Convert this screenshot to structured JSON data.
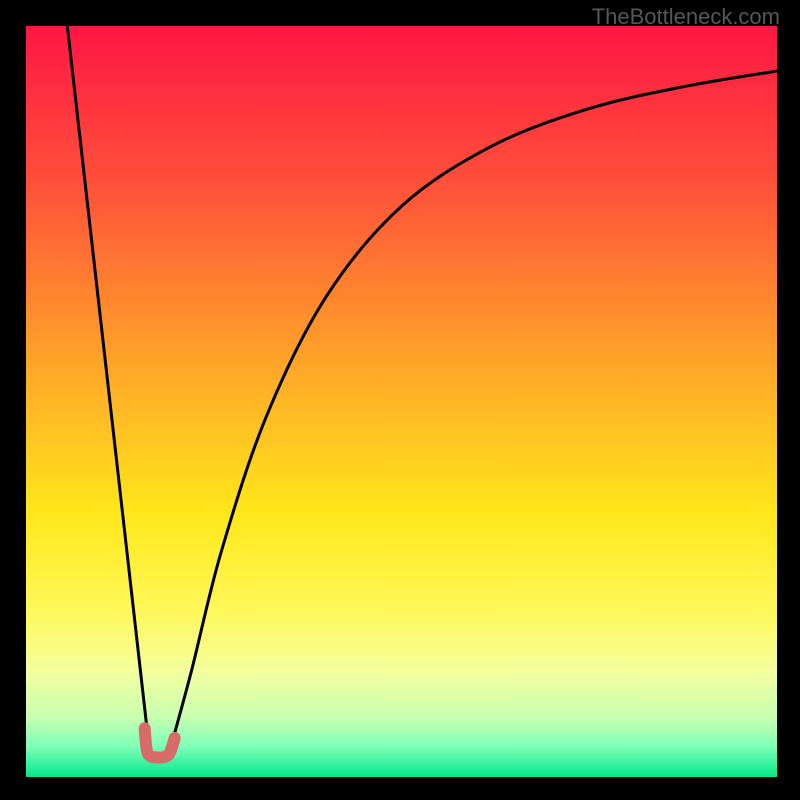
{
  "watermark": "TheBottleneck.com",
  "chart_data": {
    "type": "line",
    "title": "",
    "xlabel": "",
    "ylabel": "",
    "xlim": [
      0,
      100
    ],
    "ylim": [
      0,
      100
    ],
    "gradient_stops": [
      {
        "offset": 0,
        "color": "#ff1744"
      },
      {
        "offset": 20,
        "color": "#ff4d3a"
      },
      {
        "offset": 45,
        "color": "#ffa528"
      },
      {
        "offset": 65,
        "color": "#ffe71a"
      },
      {
        "offset": 78,
        "color": "#fff85a"
      },
      {
        "offset": 86,
        "color": "#f3ff9e"
      },
      {
        "offset": 92,
        "color": "#c8ffb0"
      },
      {
        "offset": 96,
        "color": "#7dffb8"
      },
      {
        "offset": 100,
        "color": "#00e889"
      }
    ],
    "series": [
      {
        "name": "left-line",
        "type": "line",
        "color": "#000000",
        "width": 3,
        "points": [
          {
            "x": 5.5,
            "y": 100
          },
          {
            "x": 16.5,
            "y": 3
          }
        ]
      },
      {
        "name": "right-curve",
        "type": "curve",
        "color": "#000000",
        "width": 3,
        "points": [
          {
            "x": 19,
            "y": 3
          },
          {
            "x": 22,
            "y": 14
          },
          {
            "x": 26,
            "y": 30
          },
          {
            "x": 32,
            "y": 48
          },
          {
            "x": 40,
            "y": 64
          },
          {
            "x": 50,
            "y": 76
          },
          {
            "x": 62,
            "y": 84
          },
          {
            "x": 75,
            "y": 89
          },
          {
            "x": 88,
            "y": 92
          },
          {
            "x": 100,
            "y": 94
          }
        ]
      },
      {
        "name": "highlight-hook",
        "type": "curve",
        "color": "#d86a6a",
        "width": 12,
        "linecap": "round",
        "points": [
          {
            "x": 15.8,
            "y": 6.5
          },
          {
            "x": 16.2,
            "y": 3.2
          },
          {
            "x": 17.5,
            "y": 2.6
          },
          {
            "x": 19.0,
            "y": 3.0
          },
          {
            "x": 19.8,
            "y": 5.2
          }
        ]
      }
    ]
  }
}
